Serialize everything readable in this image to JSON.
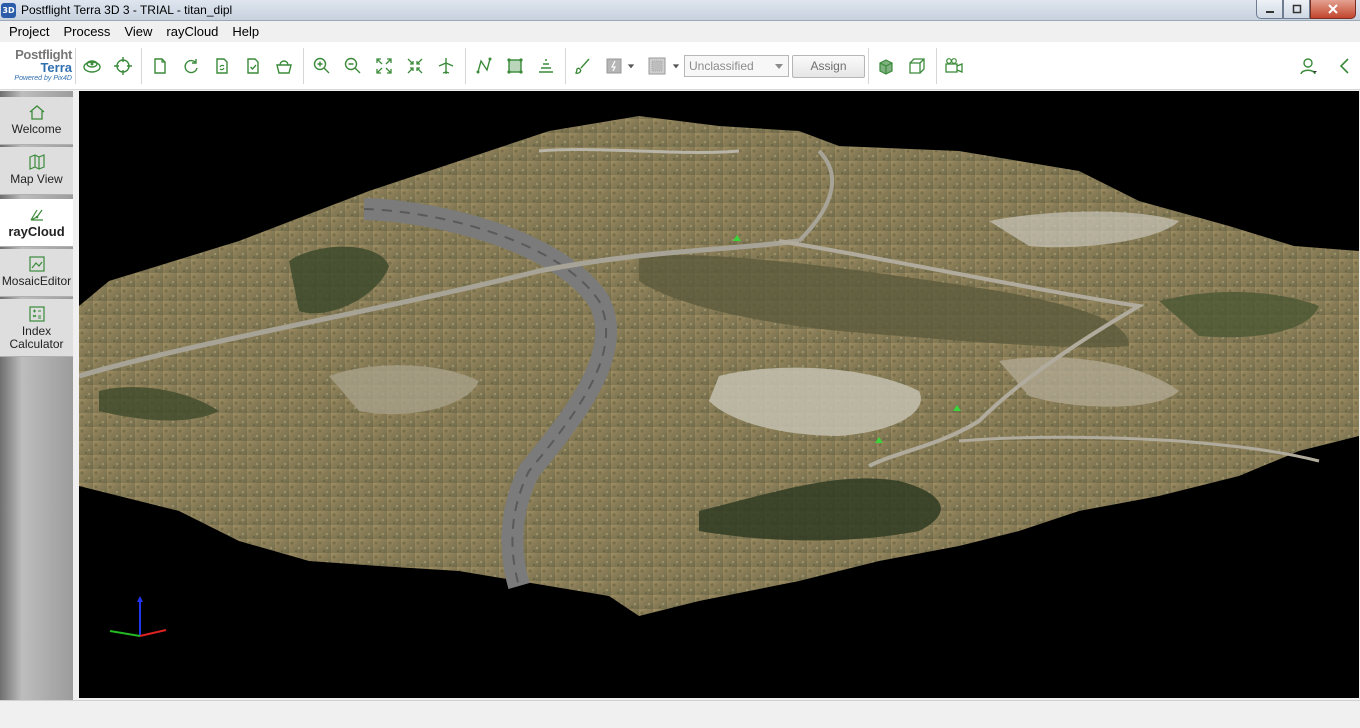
{
  "window": {
    "title": "Postflight Terra 3D 3 - TRIAL - titan_dipl",
    "app_icon_text": "3D"
  },
  "menu": [
    "Project",
    "Process",
    "View",
    "rayCloud",
    "Help"
  ],
  "logo": {
    "line1": "Postflight",
    "line2": "Terra",
    "line3": "Powered by Pix4D"
  },
  "toolbar": {
    "classification_value": "Unclassified",
    "assign_label": "Assign",
    "icons": [
      "layers-icon",
      "target-icon",
      "new-icon",
      "refresh-icon",
      "sync-icon",
      "document-check-icon",
      "basket-icon",
      "zoom-in-icon",
      "zoom-out-icon",
      "fit-view-icon",
      "collapse-icon",
      "airplane-icon",
      "polyline-icon",
      "surface-icon",
      "volume-icon",
      "brush-icon",
      "lasso-icon",
      "grid-icon",
      "cube-icon",
      "box-icon",
      "camera-icon",
      "user-icon",
      "collapse-panel-icon"
    ]
  },
  "sidebar": {
    "items": [
      {
        "label": "Welcome",
        "icon": "home-icon",
        "active": false
      },
      {
        "label": "Map View",
        "icon": "map-icon",
        "active": false
      },
      {
        "label": "rayCloud",
        "icon": "raycloud-icon",
        "active": true
      },
      {
        "label": "MosaicEditor",
        "icon": "mosaic-icon",
        "active": false
      },
      {
        "label": "Index Calculator",
        "icon": "calculator-icon",
        "active": false
      }
    ]
  },
  "colors": {
    "accent_green": "#3a8a3a",
    "viewport_bg": "#000000",
    "terrain_base": "#8c7f5c",
    "road": "#7c7c7c"
  }
}
